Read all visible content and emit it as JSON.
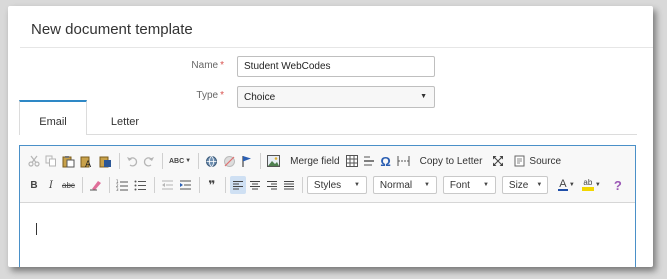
{
  "dialog": {
    "title": "New document template"
  },
  "form": {
    "name_label": "Name",
    "name_required": "*",
    "name_value": "Student WebCodes",
    "type_label": "Type",
    "type_required": "*",
    "type_value": "Choice"
  },
  "tabs": [
    {
      "label": "Email",
      "active": true
    },
    {
      "label": "Letter",
      "active": false
    }
  ],
  "toolbar": {
    "merge_field": "Merge field",
    "copy_to_letter": "Copy to Letter",
    "source": "Source",
    "styles": "Styles",
    "format": "Normal",
    "font": "Font",
    "size": "Size",
    "spell_check": "ABC",
    "bold": "B",
    "italic": "I",
    "strike": "abc",
    "font_color": "A",
    "bg_color": "ab",
    "help": "?",
    "omega": "Ω",
    "blockquote": "❞"
  },
  "colors": {
    "accent": "#2e88c6",
    "required": "#d9534f",
    "help": "#9b59b6",
    "text_color_bar": "#1f4ea8",
    "highlight_bar": "#f2d600"
  }
}
